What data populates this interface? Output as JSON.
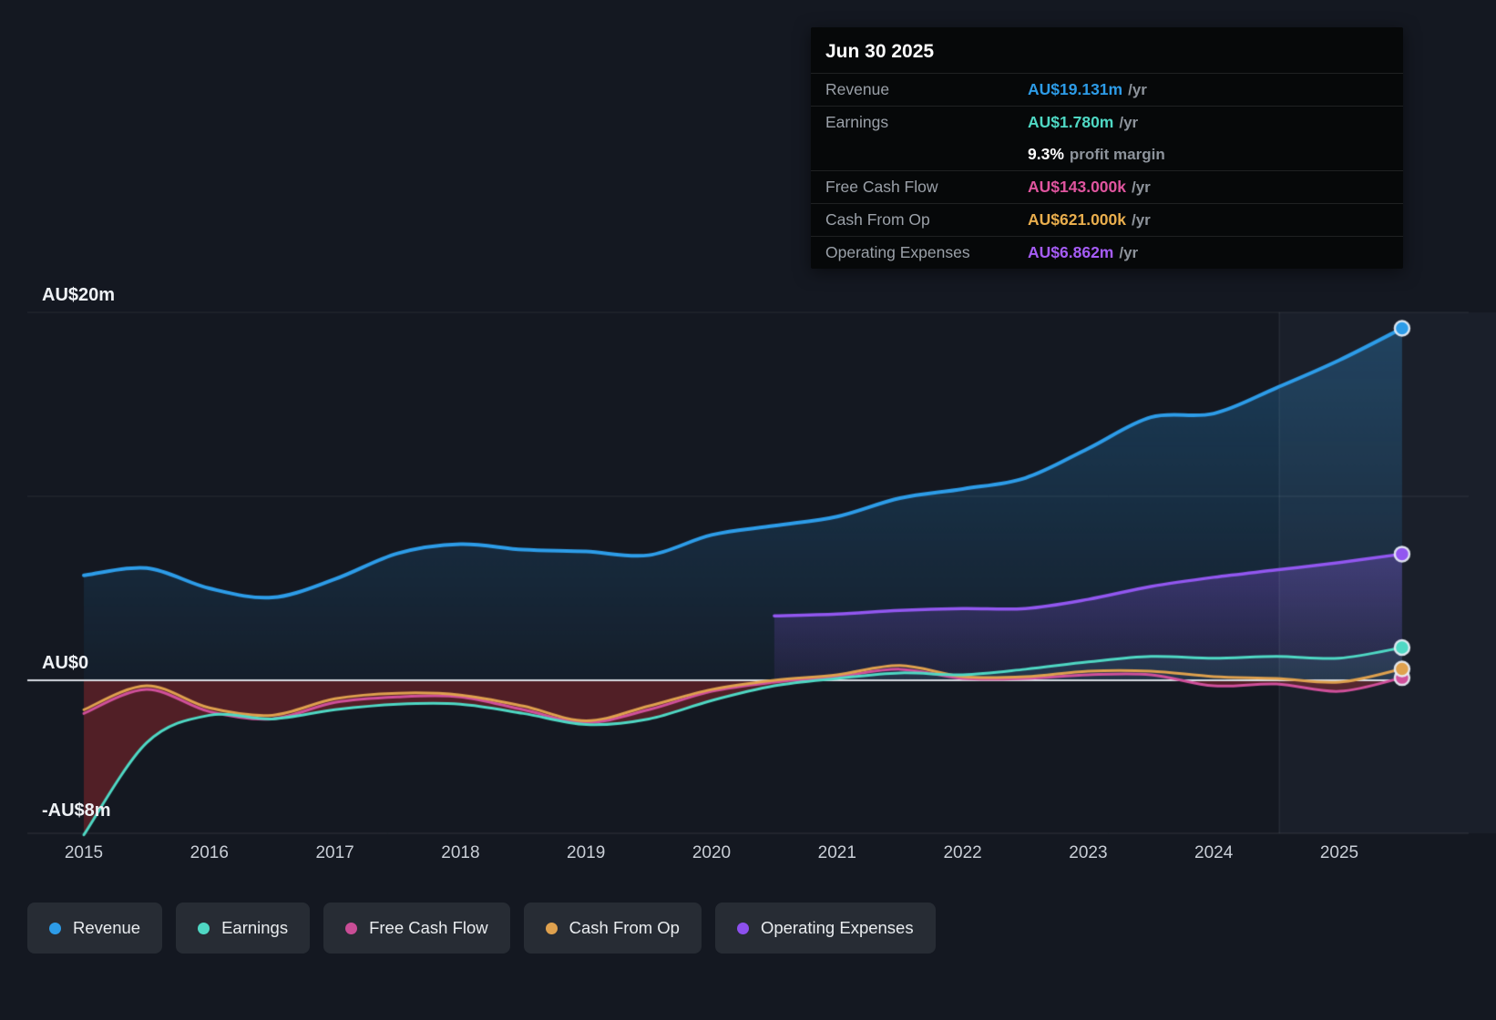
{
  "tooltip": {
    "date": "Jun 30 2025",
    "rows": [
      {
        "label": "Revenue",
        "value": "AU$19.131m",
        "suffix": "/yr",
        "color": "#2d9ce8"
      },
      {
        "label": "Earnings",
        "value": "AU$1.780m",
        "suffix": "/yr",
        "color": "#4fd8c4"
      },
      {
        "label": "",
        "value": "9.3%",
        "suffix": "profit margin",
        "color": "#ffffff"
      },
      {
        "label": "Free Cash Flow",
        "value": "AU$143.000k",
        "suffix": "/yr",
        "color": "#e0559f"
      },
      {
        "label": "Cash From Op",
        "value": "AU$621.000k",
        "suffix": "/yr",
        "color": "#e9ae4d"
      },
      {
        "label": "Operating Expenses",
        "value": "AU$6.862m",
        "suffix": "/yr",
        "color": "#a55cf5"
      }
    ]
  },
  "legend": [
    {
      "label": "Revenue",
      "color": "#2d9ce8"
    },
    {
      "label": "Earnings",
      "color": "#4fd8c4"
    },
    {
      "label": "Free Cash Flow",
      "color": "#c94d96"
    },
    {
      "label": "Cash From Op",
      "color": "#dfa14e"
    },
    {
      "label": "Operating Expenses",
      "color": "#8d50ee"
    }
  ],
  "chart_data": {
    "type": "area",
    "title": "",
    "xlabel": "",
    "ylabel": "",
    "unit": "AU$m",
    "xlim": [
      2014.55,
      2025.6
    ],
    "ylim": [
      -8.35,
      20.3
    ],
    "x_ticks": [
      2015,
      2016,
      2017,
      2018,
      2019,
      2020,
      2021,
      2022,
      2023,
      2024,
      2025
    ],
    "y_ticks": [
      {
        "value": 20,
        "label": "AU$20m",
        "grid": true
      },
      {
        "value": 10,
        "label": "",
        "grid": true
      },
      {
        "value": 0,
        "label": "AU$0",
        "grid": false
      },
      {
        "value": -8,
        "label": "-AU$8m",
        "grid": false
      }
    ],
    "x": [
      2015,
      2015.5,
      2016,
      2016.5,
      2017,
      2017.5,
      2018,
      2018.5,
      2019,
      2019.5,
      2020,
      2020.5,
      2021,
      2021.5,
      2022,
      2022.5,
      2023,
      2023.5,
      2024,
      2024.5,
      2025,
      2025.5
    ],
    "series": [
      {
        "name": "Revenue",
        "color": "#2d9ce8",
        "values": [
          5.7,
          6.1,
          5.0,
          4.5,
          5.5,
          6.9,
          7.4,
          7.1,
          7.0,
          6.8,
          7.9,
          8.4,
          8.9,
          9.9,
          10.4,
          11.0,
          12.6,
          14.3,
          14.5,
          15.9,
          17.4,
          19.131
        ]
      },
      {
        "name": "Earnings",
        "color": "#4fd8c4",
        "values": [
          -8.4,
          -3.4,
          -1.9,
          -2.1,
          -1.6,
          -1.3,
          -1.3,
          -1.8,
          -2.4,
          -2.1,
          -1.1,
          -0.3,
          0.1,
          0.4,
          0.3,
          0.6,
          1.0,
          1.3,
          1.2,
          1.3,
          1.2,
          1.78
        ]
      },
      {
        "name": "Free Cash Flow",
        "color": "#d0509b",
        "values": [
          -1.8,
          -0.5,
          -1.7,
          -2.1,
          -1.2,
          -0.9,
          -0.9,
          -1.6,
          -2.3,
          -1.6,
          -0.6,
          -0.1,
          0.2,
          0.6,
          0.1,
          0.1,
          0.3,
          0.3,
          -0.3,
          -0.2,
          -0.6,
          0.143
        ]
      },
      {
        "name": "Cash From Op",
        "color": "#dfa14e",
        "values": [
          -1.6,
          -0.3,
          -1.5,
          -1.9,
          -1.0,
          -0.7,
          -0.8,
          -1.4,
          -2.2,
          -1.4,
          -0.5,
          0.0,
          0.3,
          0.8,
          0.2,
          0.2,
          0.5,
          0.5,
          0.2,
          0.1,
          -0.1,
          0.621
        ]
      },
      {
        "name": "Operating Expenses",
        "color": "#9257f0",
        "values": [
          null,
          null,
          null,
          null,
          null,
          null,
          null,
          null,
          null,
          null,
          null,
          3.5,
          3.6,
          3.8,
          3.9,
          3.9,
          4.4,
          5.1,
          5.6,
          6.0,
          6.4,
          6.862
        ]
      }
    ],
    "legend_position": "bottom-left",
    "grid": "horizontal-only",
    "highlight_band_start_x": 2024.5
  }
}
